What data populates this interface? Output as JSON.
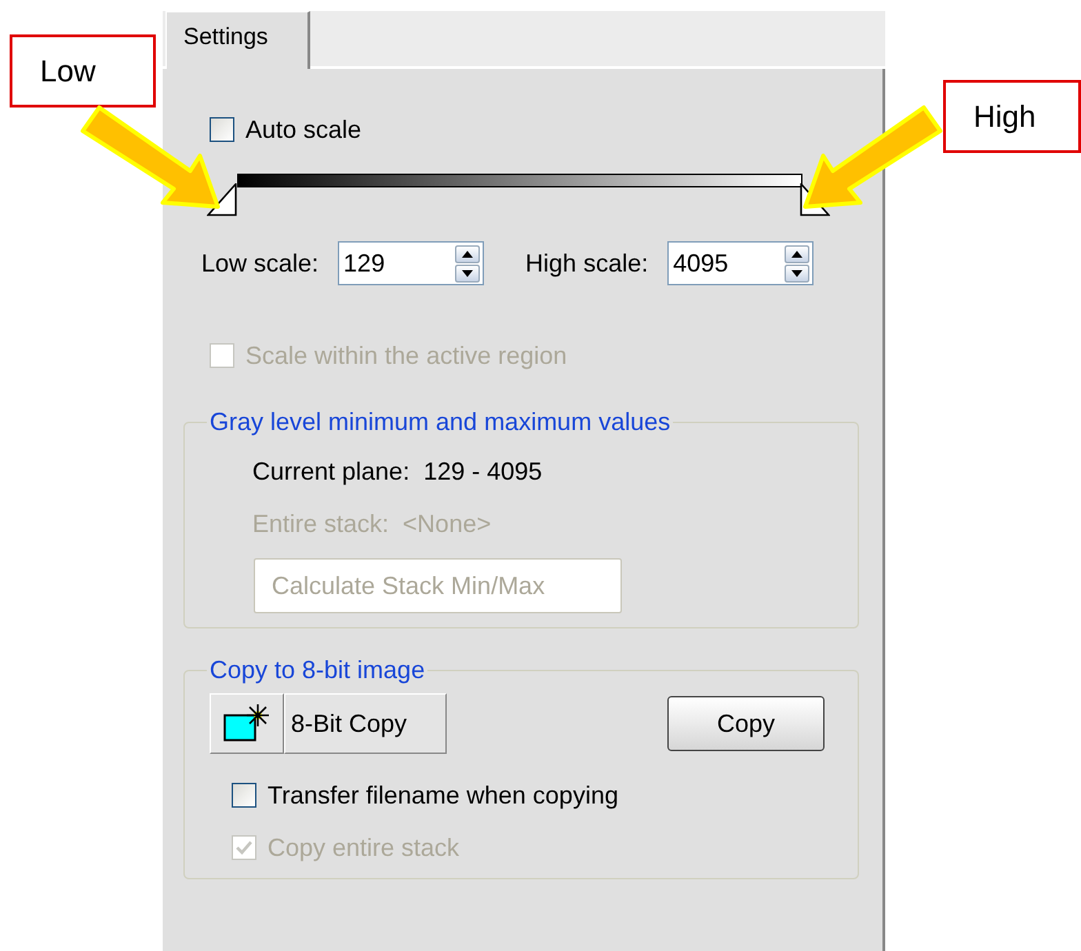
{
  "tab": {
    "label": "Settings",
    "selected": true
  },
  "auto_scale": {
    "label": "Auto scale",
    "checked": false,
    "disabled": false
  },
  "slider": {
    "low": {
      "level": 0
    },
    "high": {
      "level": 1
    }
  },
  "low_scale": {
    "label": "Low scale:",
    "value": "129"
  },
  "high_scale": {
    "label": "High scale:",
    "value": "4095"
  },
  "scale_within": {
    "label": "Scale within the active region",
    "checked": false,
    "disabled": true
  },
  "gray_group": {
    "title": "Gray level minimum and maximum values",
    "current_plane": {
      "label": "Current plane:",
      "value": "129 - 4095",
      "disabled": false
    },
    "entire_stack": {
      "label": "Entire stack:",
      "value": "<None>",
      "disabled": true
    },
    "button": {
      "label": "Calculate Stack Min/Max",
      "disabled": true
    }
  },
  "copy_group": {
    "title": "Copy to 8-bit image",
    "eight_bit_button": {
      "label": "8-Bit Copy"
    },
    "copy_button": {
      "label": "Copy"
    },
    "checkboxes": [
      {
        "label": "Transfer filename when copying",
        "checked": false,
        "disabled": false
      },
      {
        "label": "Copy entire stack",
        "checked": true,
        "disabled": true
      }
    ]
  },
  "callouts": [
    {
      "label": "Low"
    },
    {
      "label": "High"
    }
  ]
}
